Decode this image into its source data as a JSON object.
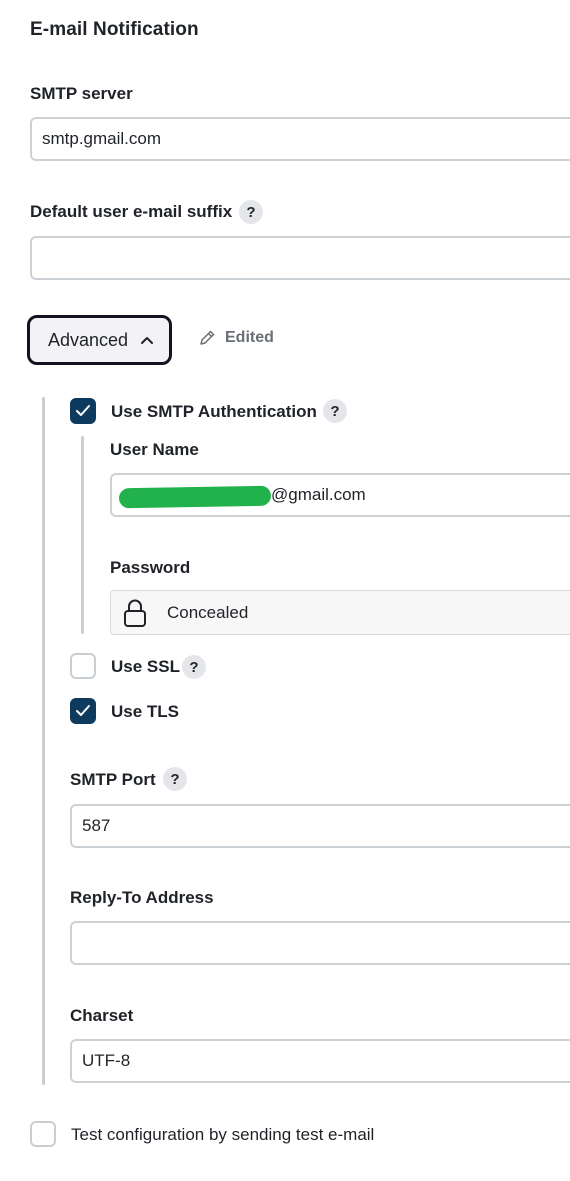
{
  "section": {
    "title": "E-mail Notification"
  },
  "smtp_server": {
    "label": "SMTP server",
    "value": "smtp.gmail.com"
  },
  "default_suffix": {
    "label": "Default user e-mail suffix",
    "value": "",
    "help": "?"
  },
  "advanced": {
    "label": "Advanced",
    "edited_label": "Edited",
    "chevron_icon": "chevron-up-icon",
    "edited_icon": "pencil-icon"
  },
  "smtp_auth": {
    "label": "Use SMTP Authentication",
    "checked": true,
    "help": "?",
    "username": {
      "label": "User Name",
      "value_visible_suffix": "@gmail.com",
      "redacted": true
    },
    "password": {
      "label": "Password",
      "value": "Concealed",
      "icon": "lock-icon"
    }
  },
  "use_ssl": {
    "label": "Use SSL",
    "checked": false,
    "help": "?"
  },
  "use_tls": {
    "label": "Use TLS",
    "checked": true
  },
  "smtp_port": {
    "label": "SMTP Port",
    "value": "587",
    "help": "?"
  },
  "reply_to": {
    "label": "Reply-To Address",
    "value": ""
  },
  "charset": {
    "label": "Charset",
    "value": "UTF-8"
  },
  "test_config": {
    "label": "Test configuration by sending test e-mail",
    "checked": false
  },
  "colors": {
    "checkbox_checked": "#0e3a5e",
    "redaction": "#22b24c",
    "border": "#ccd1d6",
    "help_bg": "#e4e6e9"
  }
}
